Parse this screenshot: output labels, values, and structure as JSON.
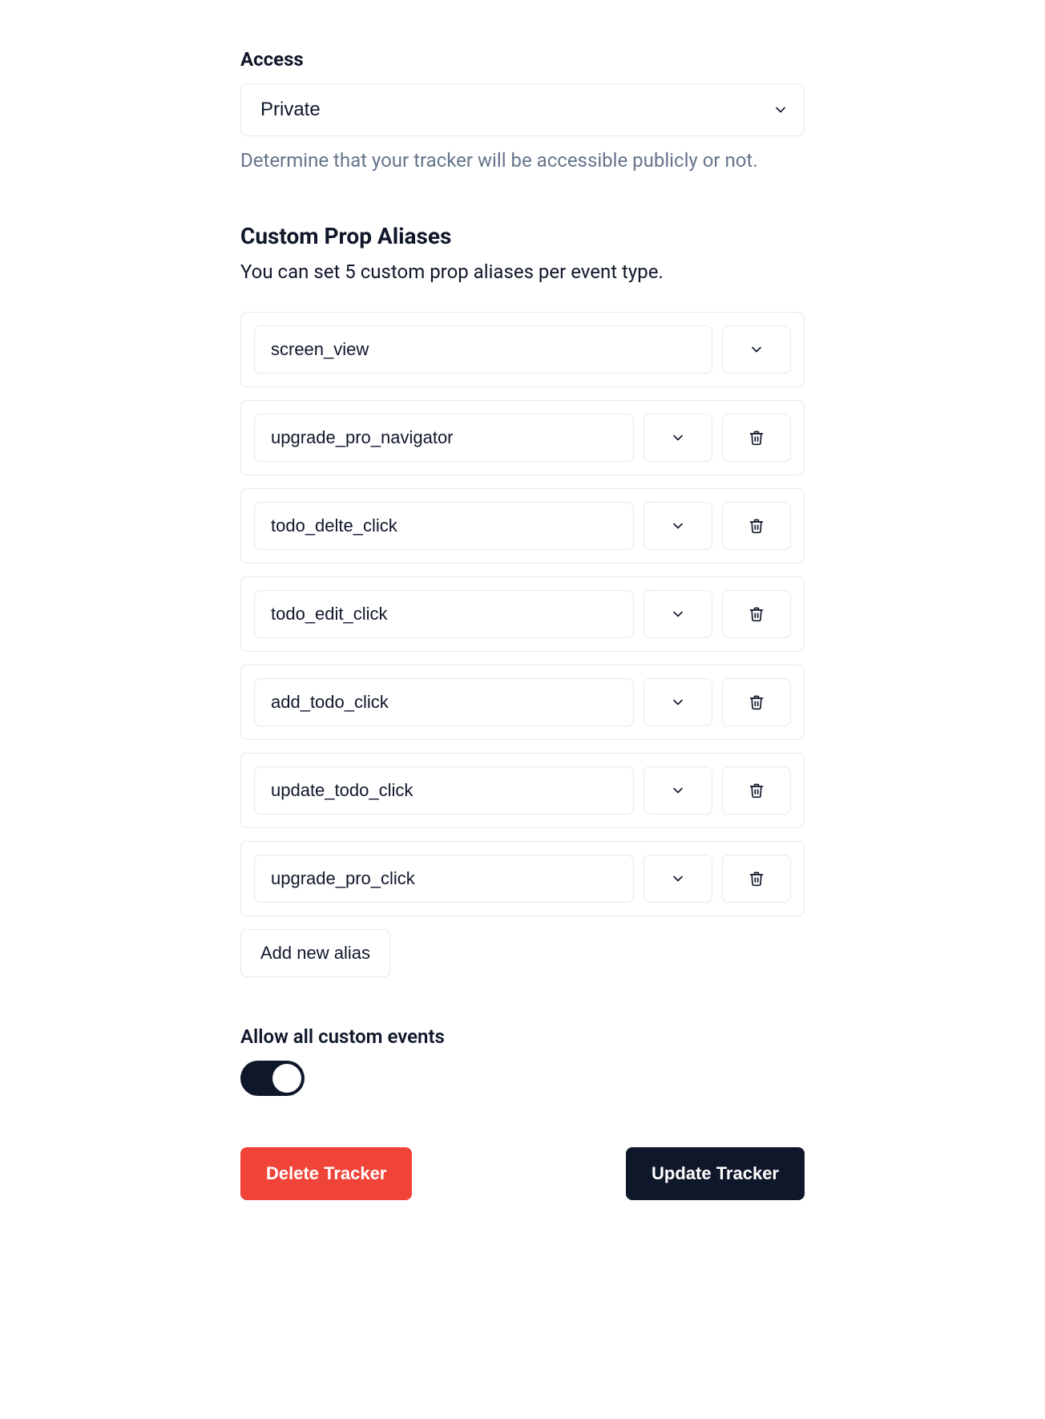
{
  "access": {
    "label": "Access",
    "value": "Private",
    "help_text": "Determine that your tracker will be accessible publicly or not."
  },
  "aliases": {
    "heading": "Custom Prop Aliases",
    "description": "You can set 5 custom prop aliases per event type.",
    "items": [
      {
        "value": "screen_view",
        "has_delete": false
      },
      {
        "value": "upgrade_pro_navigator",
        "has_delete": true
      },
      {
        "value": "todo_delte_click",
        "has_delete": true
      },
      {
        "value": "todo_edit_click",
        "has_delete": true
      },
      {
        "value": "add_todo_click",
        "has_delete": true
      },
      {
        "value": "update_todo_click",
        "has_delete": true
      },
      {
        "value": "upgrade_pro_click",
        "has_delete": true
      }
    ],
    "add_button_label": "Add new alias"
  },
  "toggle": {
    "label": "Allow all custom events",
    "enabled": true
  },
  "actions": {
    "delete_label": "Delete Tracker",
    "update_label": "Update Tracker"
  }
}
